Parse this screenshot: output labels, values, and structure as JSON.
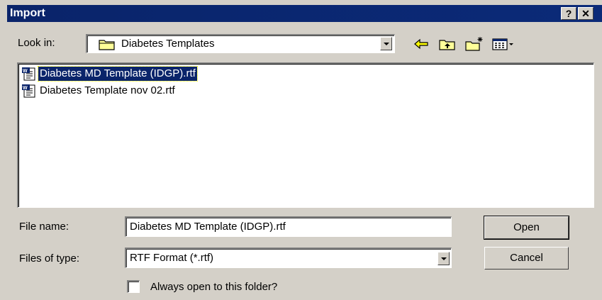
{
  "window": {
    "title": "Import",
    "help_button": "?",
    "close_button": "✕"
  },
  "lookin": {
    "label": "Look in:",
    "value": "Diabetes Templates",
    "icon": "folder-icon"
  },
  "toolbar": {
    "icons": [
      "back-arrow-icon",
      "up-one-level-icon",
      "new-folder-icon",
      "view-menu-icon"
    ]
  },
  "files": [
    {
      "name": "Diabetes MD Template (IDGP).rtf",
      "selected": true,
      "icon": "rtf-document-icon"
    },
    {
      "name": "Diabetes Template nov 02.rtf",
      "selected": false,
      "icon": "rtf-document-icon"
    }
  ],
  "filename": {
    "label": "File name:",
    "value": "Diabetes MD Template (IDGP).rtf"
  },
  "filetype": {
    "label": "Files of type:",
    "value": "RTF Format (*.rtf)"
  },
  "buttons": {
    "open": "Open",
    "cancel": "Cancel"
  },
  "checkbox": {
    "label": "Always open to this folder?",
    "checked": false
  },
  "colors": {
    "titlebar": "#0a246a",
    "face": "#d4d0c8",
    "selection": "#0a246a"
  }
}
